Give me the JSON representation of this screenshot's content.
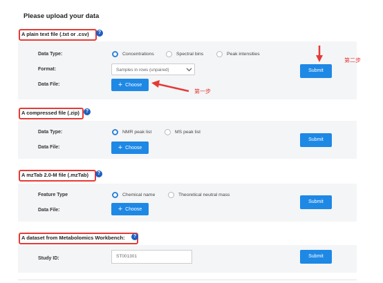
{
  "page_title": "Please upload your data",
  "help_glyph": "?",
  "plus_glyph": "+",
  "sections": [
    {
      "title": "A plain text file (.txt or .csv)",
      "data_type_label": "Data Type:",
      "data_type_options": [
        "Concentrations",
        "Spectral bins",
        "Peak intensities"
      ],
      "selected": "Concentrations",
      "format_label": "Format:",
      "format_value": "Samples in rows (unpaired)",
      "file_label": "Data File:",
      "choose_label": "Choose",
      "submit_label": "Submit"
    },
    {
      "title": "A compressed file (.zip)",
      "data_type_label": "Data Type:",
      "data_type_options": [
        "NMR peak list",
        "MS peak list"
      ],
      "selected": "NMR peak list",
      "file_label": "Data File:",
      "choose_label": "Choose",
      "submit_label": "Submit"
    },
    {
      "title": "A mzTab 2.0-M file (.mzTab)",
      "feature_type_label": "Feature Type",
      "feature_type_options": [
        "Chemical name",
        "Theoretical neutral mass"
      ],
      "selected": "Chemical name",
      "file_label": "Data File:",
      "choose_label": "Choose",
      "submit_label": "Submit"
    },
    {
      "title": "A dataset from Metabolomics Workbench:",
      "study_id_label": "Study ID:",
      "study_id_value": "ST001301",
      "submit_label": "Submit"
    }
  ],
  "annotations": {
    "step1": "第一步",
    "step2": "第二步"
  },
  "colors": {
    "accent": "#1e88e5",
    "annotation_red": "#e53935",
    "panel_bg": "#f4f5f7"
  }
}
